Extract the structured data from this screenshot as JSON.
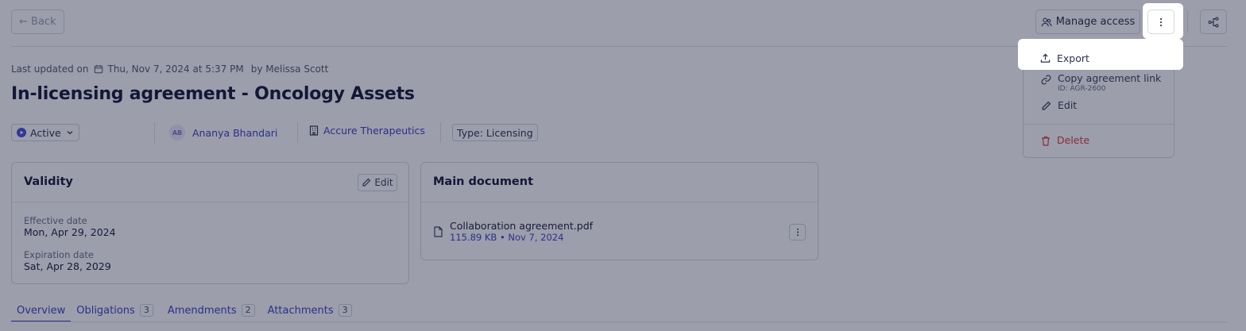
{
  "header": {
    "back_label": "← Back",
    "manage_access_label": "Manage access"
  },
  "agreement": {
    "updated_prefix": "Last updated on",
    "updated_date": "Thu, Nov 7, 2024 at 5:37 PM",
    "updated_by": "by Melissa Scott",
    "title": "In-licensing agreement - Oncology Assets",
    "status": "Active",
    "owner_initials": "AB",
    "owner_name": "Ananya Bhandari",
    "company": "Accure Therapeutics",
    "type": "Type: Licensing"
  },
  "validity": {
    "title": "Validity",
    "edit_label": "Edit",
    "effective_label": "Effective date",
    "effective_value": "Mon, Apr 29, 2024",
    "expiration_label": "Expiration date",
    "expiration_value": "Sat, Apr 28, 2029"
  },
  "main_document": {
    "title": "Main document",
    "file_name": "Collaboration agreement.pdf",
    "file_meta": "115.89 KB • Nov 7, 2024"
  },
  "tabs": [
    {
      "label": "Overview",
      "count": ""
    },
    {
      "label": "Obligations",
      "count": "3"
    },
    {
      "label": "Amendments",
      "count": "2"
    },
    {
      "label": "Attachments",
      "count": "3"
    }
  ],
  "menu": {
    "export": "Export",
    "copy_link": "Copy agreement link",
    "copy_link_sub": "ID: AGR-2600",
    "edit": "Edit",
    "delete": "Delete"
  },
  "colors": {
    "accent": "#3d42c4",
    "danger": "#d9413b",
    "overlay": "rgba(20, 24, 55, 0.42)"
  }
}
